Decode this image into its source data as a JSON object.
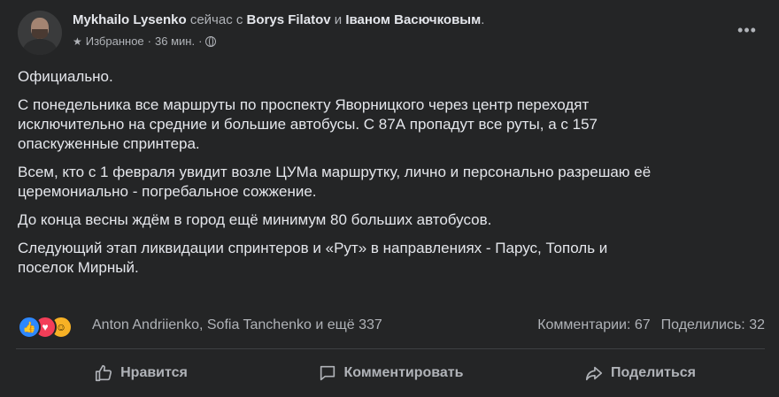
{
  "post": {
    "author": "Mykhailo Lysenko",
    "now_text": "сейчас с",
    "tag1": "Borys Filatov",
    "and_text": "и",
    "tag2": "Іваном Васючковым",
    "period": ".",
    "audience": "Избранное",
    "sep": "·",
    "time": "36 мин.",
    "sep2": "·",
    "more_icon": "more-dots-icon",
    "paragraphs": [
      "Официально.",
      "С понедельника все маршруты по проспекту Яворницкого через центр переходят\nисключительно на средние и большие автобусы. С 87А пропадут все руты, а с 157\nопаскуженные спринтера.",
      "Всем, кто с 1 февраля увидит возле ЦУМа маршрутку, лично и персонально разрешаю её\nцеремониально - погребальное сожжение.",
      "До конца весны ждём в город ещё минимум 80 больших автобусов.",
      "Следующий этап ликвидации спринтеров и «Рут»   в направлениях - Парус, Тополь и\nпоселок Мирный."
    ]
  },
  "reactions": {
    "icons": [
      "like-icon",
      "love-icon",
      "haha-icon"
    ],
    "names": "Anton Andriienko, Sofia Tanchenko и ещё 337",
    "comments": "Комментарии: 67",
    "shares": "Поделились: 32"
  },
  "actions": {
    "like": "Нравится",
    "comment": "Комментировать",
    "share": "Поделиться"
  },
  "colors": {
    "background": "#242526",
    "text": "#e4e6eb",
    "muted": "#b0b3b8",
    "like_blue": "#2d88ff",
    "love_red": "#f33e58",
    "haha_yellow": "#f7b125"
  }
}
